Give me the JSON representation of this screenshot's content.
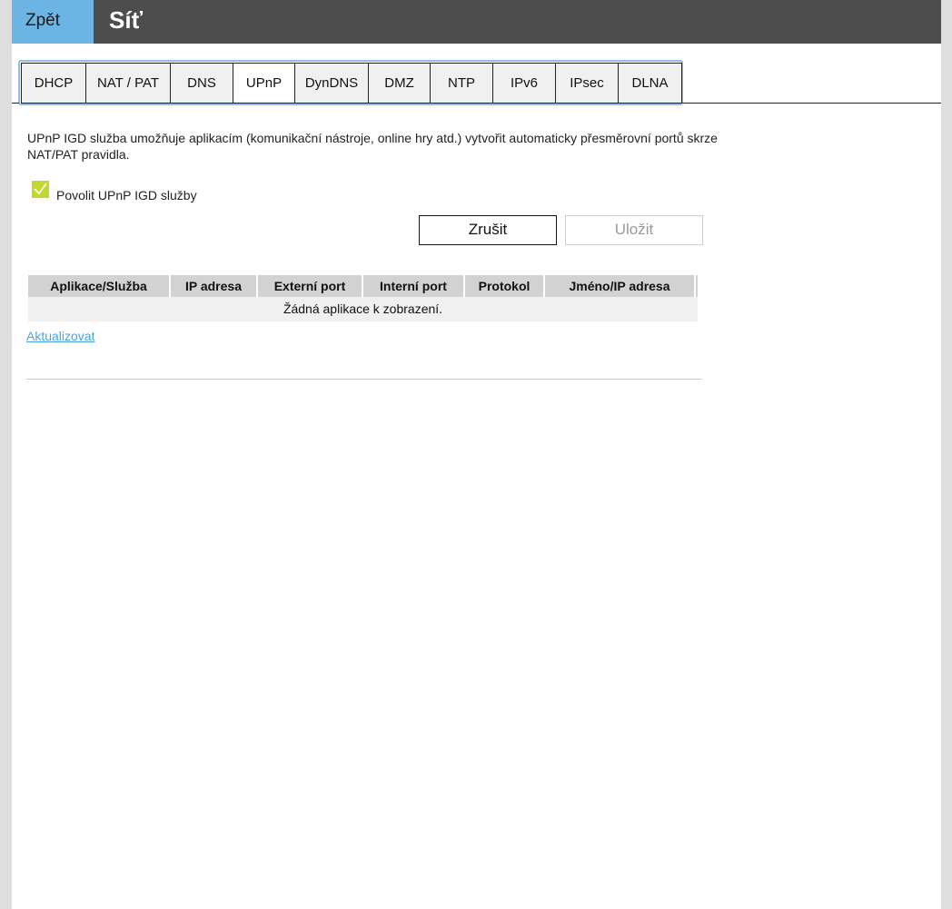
{
  "header": {
    "back_label": "Zpět",
    "title": "Síť",
    "colors": {
      "bar": "#4d4d4d",
      "back_button": "#6cb4e4"
    }
  },
  "tabs": [
    {
      "label": "DHCP",
      "active": false
    },
    {
      "label": "NAT / PAT",
      "active": false
    },
    {
      "label": "DNS",
      "active": false
    },
    {
      "label": "UPnP",
      "active": true
    },
    {
      "label": "DynDNS",
      "active": false
    },
    {
      "label": "DMZ",
      "active": false
    },
    {
      "label": "NTP",
      "active": false
    },
    {
      "label": "IPv6",
      "active": false
    },
    {
      "label": "IPsec",
      "active": false
    },
    {
      "label": "DLNA",
      "active": false
    }
  ],
  "upnp": {
    "description": "UPnP IGD služba umožňuje aplikacím (komunikační nástroje, online hry atd.) vytvořit automaticky přesměrovní portů skrze NAT/PAT pravidla.",
    "enable_checkbox": {
      "label": "Povolit UPnP IGD služby",
      "checked": true,
      "color": "#c3d82e"
    },
    "cancel_label": "Zrušit",
    "save_label": "Uložit",
    "save_enabled": false
  },
  "table": {
    "headers": [
      "Aplikace/Služba",
      "IP adresa",
      "Externí port",
      "Interní port",
      "Protokol",
      "Jméno/IP adresa"
    ],
    "rows": [],
    "empty_message": "Žádná aplikace k zobrazení."
  },
  "refresh_link": "Aktualizovat",
  "link_color": "#4aa3df"
}
